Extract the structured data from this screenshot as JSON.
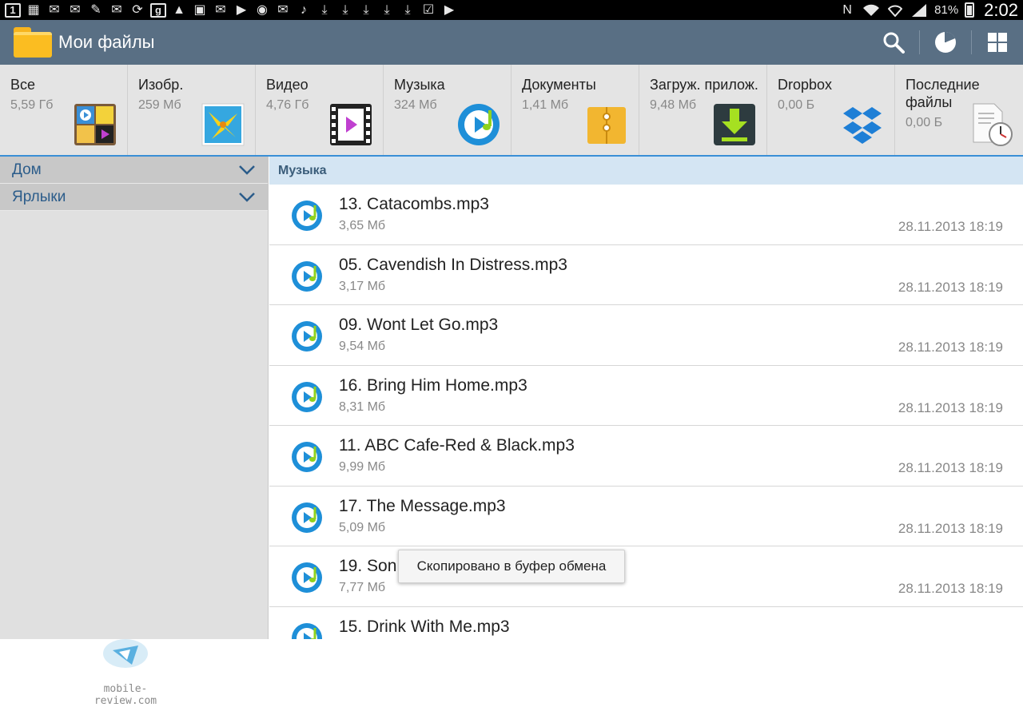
{
  "statusbar": {
    "left_icons": [
      "notification-1-icon",
      "calendar-icon",
      "mail-icon",
      "mail-icon",
      "pin-icon",
      "mail-icon",
      "sync-icon",
      "google-plus-icon",
      "warning-icon",
      "image-icon",
      "mail-alt-icon",
      "play-icon",
      "voice-icon",
      "gmail-icon",
      "twitter-icon",
      "download-icon",
      "download-icon",
      "download-icon",
      "download-icon",
      "download-icon",
      "checkbox-icon",
      "play-store-icon"
    ],
    "battery_percent": "81%",
    "time": "2:02"
  },
  "actionbar": {
    "title": "Мои файлы",
    "actions": [
      "search-icon",
      "storage-pie-icon",
      "grid-view-icon"
    ]
  },
  "categories": [
    {
      "name": "Все",
      "size": "5,59 Гб",
      "icon": "all-files-icon"
    },
    {
      "name": "Изобр.",
      "size": "259 Мб",
      "icon": "images-icon"
    },
    {
      "name": "Видео",
      "size": "4,76 Гб",
      "icon": "video-icon"
    },
    {
      "name": "Музыка",
      "size": "324 Мб",
      "icon": "music-icon"
    },
    {
      "name": "Документы",
      "size": "1,41 Мб",
      "icon": "documents-icon"
    },
    {
      "name": "Загруж. прилож.",
      "size": "9,48 Мб",
      "icon": "downloaded-apps-icon"
    },
    {
      "name": "Dropbox",
      "size": "0,00 Б",
      "icon": "dropbox-icon"
    },
    {
      "name": "Последние файлы",
      "size": "0,00 Б",
      "icon": "recent-files-icon"
    }
  ],
  "sidebar": {
    "items": [
      {
        "label": "Дом"
      },
      {
        "label": "Ярлыки"
      }
    ],
    "watermark": "mobile-review.com"
  },
  "main": {
    "section_title": "Музыка",
    "files": [
      {
        "name": "13. Catacombs.mp3",
        "size": "3,65 Мб",
        "date": "28.11.2013 18:19"
      },
      {
        "name": "05. Cavendish In Distress.mp3",
        "size": "3,17 Мб",
        "date": "28.11.2013 18:19"
      },
      {
        "name": "09. Wont Let Go.mp3",
        "size": "9,54 Мб",
        "date": "28.11.2013 18:19"
      },
      {
        "name": "16. Bring Him Home.mp3",
        "size": "8,31 Мб",
        "date": "28.11.2013 18:19"
      },
      {
        "name": "11. ABC Cafe-Red & Black.mp3",
        "size": "9,99 Мб",
        "date": "28.11.2013 18:19"
      },
      {
        "name": "17. The Message.mp3",
        "size": "5,09 Мб",
        "date": "28.11.2013 18:19"
      },
      {
        "name": "19. Son",
        "size": "7,77 Мб",
        "date": "28.11.2013 18:19"
      },
      {
        "name": "15. Drink With Me.mp3",
        "size": "",
        "date": ""
      }
    ]
  },
  "toast": {
    "text": "Скопировано в буфер обмена"
  },
  "colors": {
    "actionbar": "#596f84",
    "tabs_bg": "#e4e4e4",
    "section_header": "#d4e5f3",
    "accent": "#3a8fd6"
  }
}
